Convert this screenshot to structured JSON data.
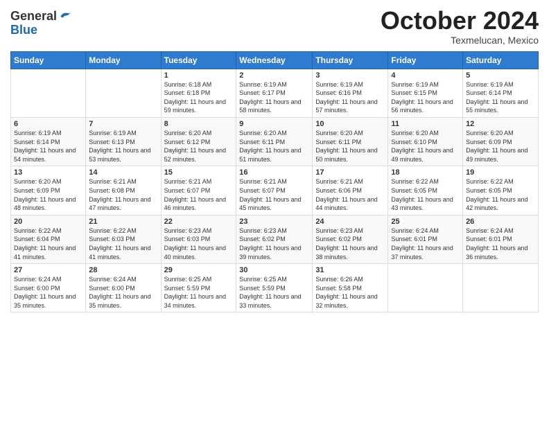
{
  "logo": {
    "general": "General",
    "blue": "Blue"
  },
  "header": {
    "month": "October 2024",
    "location": "Texmelucan, Mexico"
  },
  "weekdays": [
    "Sunday",
    "Monday",
    "Tuesday",
    "Wednesday",
    "Thursday",
    "Friday",
    "Saturday"
  ],
  "weeks": [
    [
      {
        "day": "",
        "sunrise": "",
        "sunset": "",
        "daylight": ""
      },
      {
        "day": "",
        "sunrise": "",
        "sunset": "",
        "daylight": ""
      },
      {
        "day": "1",
        "sunrise": "Sunrise: 6:18 AM",
        "sunset": "Sunset: 6:18 PM",
        "daylight": "Daylight: 11 hours and 59 minutes."
      },
      {
        "day": "2",
        "sunrise": "Sunrise: 6:19 AM",
        "sunset": "Sunset: 6:17 PM",
        "daylight": "Daylight: 11 hours and 58 minutes."
      },
      {
        "day": "3",
        "sunrise": "Sunrise: 6:19 AM",
        "sunset": "Sunset: 6:16 PM",
        "daylight": "Daylight: 11 hours and 57 minutes."
      },
      {
        "day": "4",
        "sunrise": "Sunrise: 6:19 AM",
        "sunset": "Sunset: 6:15 PM",
        "daylight": "Daylight: 11 hours and 56 minutes."
      },
      {
        "day": "5",
        "sunrise": "Sunrise: 6:19 AM",
        "sunset": "Sunset: 6:14 PM",
        "daylight": "Daylight: 11 hours and 55 minutes."
      }
    ],
    [
      {
        "day": "6",
        "sunrise": "Sunrise: 6:19 AM",
        "sunset": "Sunset: 6:14 PM",
        "daylight": "Daylight: 11 hours and 54 minutes."
      },
      {
        "day": "7",
        "sunrise": "Sunrise: 6:19 AM",
        "sunset": "Sunset: 6:13 PM",
        "daylight": "Daylight: 11 hours and 53 minutes."
      },
      {
        "day": "8",
        "sunrise": "Sunrise: 6:20 AM",
        "sunset": "Sunset: 6:12 PM",
        "daylight": "Daylight: 11 hours and 52 minutes."
      },
      {
        "day": "9",
        "sunrise": "Sunrise: 6:20 AM",
        "sunset": "Sunset: 6:11 PM",
        "daylight": "Daylight: 11 hours and 51 minutes."
      },
      {
        "day": "10",
        "sunrise": "Sunrise: 6:20 AM",
        "sunset": "Sunset: 6:11 PM",
        "daylight": "Daylight: 11 hours and 50 minutes."
      },
      {
        "day": "11",
        "sunrise": "Sunrise: 6:20 AM",
        "sunset": "Sunset: 6:10 PM",
        "daylight": "Daylight: 11 hours and 49 minutes."
      },
      {
        "day": "12",
        "sunrise": "Sunrise: 6:20 AM",
        "sunset": "Sunset: 6:09 PM",
        "daylight": "Daylight: 11 hours and 49 minutes."
      }
    ],
    [
      {
        "day": "13",
        "sunrise": "Sunrise: 6:20 AM",
        "sunset": "Sunset: 6:09 PM",
        "daylight": "Daylight: 11 hours and 48 minutes."
      },
      {
        "day": "14",
        "sunrise": "Sunrise: 6:21 AM",
        "sunset": "Sunset: 6:08 PM",
        "daylight": "Daylight: 11 hours and 47 minutes."
      },
      {
        "day": "15",
        "sunrise": "Sunrise: 6:21 AM",
        "sunset": "Sunset: 6:07 PM",
        "daylight": "Daylight: 11 hours and 46 minutes."
      },
      {
        "day": "16",
        "sunrise": "Sunrise: 6:21 AM",
        "sunset": "Sunset: 6:07 PM",
        "daylight": "Daylight: 11 hours and 45 minutes."
      },
      {
        "day": "17",
        "sunrise": "Sunrise: 6:21 AM",
        "sunset": "Sunset: 6:06 PM",
        "daylight": "Daylight: 11 hours and 44 minutes."
      },
      {
        "day": "18",
        "sunrise": "Sunrise: 6:22 AM",
        "sunset": "Sunset: 6:05 PM",
        "daylight": "Daylight: 11 hours and 43 minutes."
      },
      {
        "day": "19",
        "sunrise": "Sunrise: 6:22 AM",
        "sunset": "Sunset: 6:05 PM",
        "daylight": "Daylight: 11 hours and 42 minutes."
      }
    ],
    [
      {
        "day": "20",
        "sunrise": "Sunrise: 6:22 AM",
        "sunset": "Sunset: 6:04 PM",
        "daylight": "Daylight: 11 hours and 41 minutes."
      },
      {
        "day": "21",
        "sunrise": "Sunrise: 6:22 AM",
        "sunset": "Sunset: 6:03 PM",
        "daylight": "Daylight: 11 hours and 41 minutes."
      },
      {
        "day": "22",
        "sunrise": "Sunrise: 6:23 AM",
        "sunset": "Sunset: 6:03 PM",
        "daylight": "Daylight: 11 hours and 40 minutes."
      },
      {
        "day": "23",
        "sunrise": "Sunrise: 6:23 AM",
        "sunset": "Sunset: 6:02 PM",
        "daylight": "Daylight: 11 hours and 39 minutes."
      },
      {
        "day": "24",
        "sunrise": "Sunrise: 6:23 AM",
        "sunset": "Sunset: 6:02 PM",
        "daylight": "Daylight: 11 hours and 38 minutes."
      },
      {
        "day": "25",
        "sunrise": "Sunrise: 6:24 AM",
        "sunset": "Sunset: 6:01 PM",
        "daylight": "Daylight: 11 hours and 37 minutes."
      },
      {
        "day": "26",
        "sunrise": "Sunrise: 6:24 AM",
        "sunset": "Sunset: 6:01 PM",
        "daylight": "Daylight: 11 hours and 36 minutes."
      }
    ],
    [
      {
        "day": "27",
        "sunrise": "Sunrise: 6:24 AM",
        "sunset": "Sunset: 6:00 PM",
        "daylight": "Daylight: 11 hours and 35 minutes."
      },
      {
        "day": "28",
        "sunrise": "Sunrise: 6:24 AM",
        "sunset": "Sunset: 6:00 PM",
        "daylight": "Daylight: 11 hours and 35 minutes."
      },
      {
        "day": "29",
        "sunrise": "Sunrise: 6:25 AM",
        "sunset": "Sunset: 5:59 PM",
        "daylight": "Daylight: 11 hours and 34 minutes."
      },
      {
        "day": "30",
        "sunrise": "Sunrise: 6:25 AM",
        "sunset": "Sunset: 5:59 PM",
        "daylight": "Daylight: 11 hours and 33 minutes."
      },
      {
        "day": "31",
        "sunrise": "Sunrise: 6:26 AM",
        "sunset": "Sunset: 5:58 PM",
        "daylight": "Daylight: 11 hours and 32 minutes."
      },
      {
        "day": "",
        "sunrise": "",
        "sunset": "",
        "daylight": ""
      },
      {
        "day": "",
        "sunrise": "",
        "sunset": "",
        "daylight": ""
      }
    ]
  ]
}
